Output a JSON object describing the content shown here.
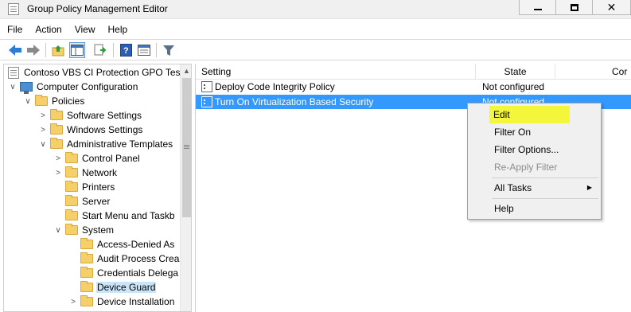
{
  "window": {
    "title": "Group Policy Management Editor",
    "close_glyph": "✕"
  },
  "menu": [
    "File",
    "Action",
    "View",
    "Help"
  ],
  "toolbar": {
    "buttons": [
      "back-icon",
      "forward-icon",
      "up-folder-icon",
      "show-hide-tree-icon",
      "export-list-icon",
      "help-icon",
      "properties-icon",
      "filter-icon"
    ]
  },
  "tree": {
    "root": "Contoso VBS CI Protection GPO Test",
    "items": [
      {
        "label": "Computer Configuration",
        "chevron": "∨"
      },
      {
        "label": "Policies",
        "chevron": "∨"
      },
      {
        "label": "Software Settings",
        "chevron": ">"
      },
      {
        "label": "Windows Settings",
        "chevron": ">"
      },
      {
        "label": "Administrative Templates",
        "chevron": "∨"
      },
      {
        "label": "Control Panel",
        "chevron": ">"
      },
      {
        "label": "Network",
        "chevron": ">"
      },
      {
        "label": "Printers",
        "chevron": ""
      },
      {
        "label": "Server",
        "chevron": ""
      },
      {
        "label": "Start Menu and Taskb",
        "chevron": ""
      },
      {
        "label": "System",
        "chevron": "∨"
      },
      {
        "label": "Access-Denied As",
        "chevron": ""
      },
      {
        "label": "Audit Process Crea",
        "chevron": ""
      },
      {
        "label": "Credentials Delega",
        "chevron": ""
      },
      {
        "label": "Device Guard",
        "chevron": ""
      },
      {
        "label": "Device Installation",
        "chevron": ">"
      }
    ],
    "scroll_up": "▲"
  },
  "list": {
    "columns": [
      "Setting",
      "State",
      "Cor"
    ],
    "rows": [
      {
        "setting": "Deploy Code Integrity Policy",
        "state": "Not configured"
      },
      {
        "setting": "Turn On Virtualization Based Security",
        "state": "Not configured"
      }
    ]
  },
  "context_menu": {
    "items": [
      "Edit",
      "Filter On",
      "Filter Options...",
      "Re-Apply Filter",
      "All Tasks",
      "Help"
    ],
    "submenu_arrow": "▶"
  },
  "colors": {
    "selection": "#3399ff",
    "highlight": "#f4f63c",
    "folder": "#f5cf6a"
  }
}
